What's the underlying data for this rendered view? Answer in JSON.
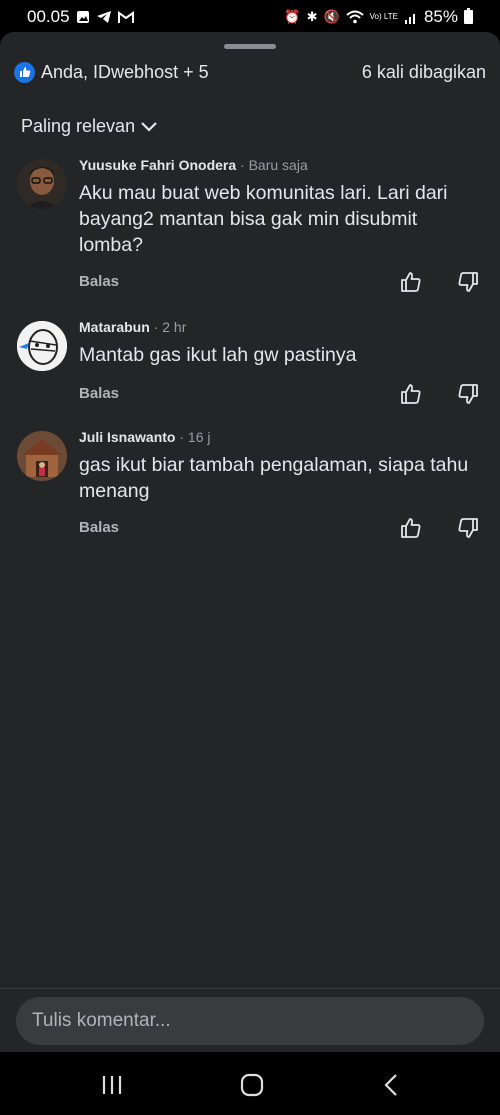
{
  "status_bar": {
    "time": "00.05",
    "battery": "85%",
    "network": "Vo) LTE"
  },
  "reactions": {
    "names": "Anda, IDwebhost + 5",
    "shares": "6 kali dibagikan"
  },
  "sort": {
    "label": "Paling relevan"
  },
  "comments": [
    {
      "author": "Yuusuke Fahri Onodera",
      "time": "· Baru saja",
      "text": "Aku mau buat web komunitas lari. Lari dari bayang2 mantan bisa gak min disubmit lomba?",
      "reply": "Balas"
    },
    {
      "author": "Matarabun",
      "time": "· 2 hr",
      "text": "Mantab gas ikut lah gw pastinya",
      "reply": "Balas"
    },
    {
      "author": "Juli Isnawanto",
      "time": "· 16 j",
      "text": "gas ikut biar tambah pengalaman, siapa tahu menang",
      "reply": "Balas"
    }
  ],
  "composer": {
    "placeholder": "Tulis komentar..."
  },
  "colors": {
    "like_blue": "#1b74e4",
    "sheet_bg": "#242526",
    "input_bg": "#3a3b3c"
  }
}
